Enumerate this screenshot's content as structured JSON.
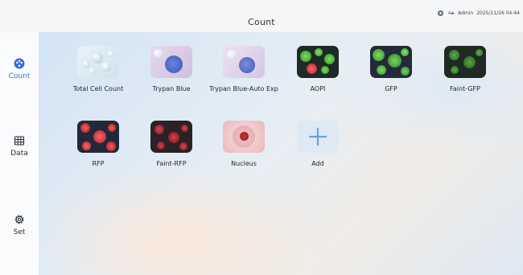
{
  "header": {
    "title": "Count",
    "user": "Admin",
    "datetime": "2025/11/26 04:44"
  },
  "sidebar": {
    "items": [
      {
        "label": "Count",
        "icon": "palette-icon",
        "active": true
      },
      {
        "label": "Data",
        "icon": "table-icon",
        "active": false
      },
      {
        "label": "Set",
        "icon": "gear-icon",
        "active": false
      }
    ]
  },
  "apps": [
    {
      "label": "Total Cell Count",
      "icon": "white-cells-icon"
    },
    {
      "label": "Trypan Blue",
      "icon": "blue-cell-icon"
    },
    {
      "label": "Trypan Blue-Auto Exp",
      "icon": "blue-cell-auto-icon"
    },
    {
      "label": "AOPI",
      "icon": "green-red-cells-icon"
    },
    {
      "label": "GFP",
      "icon": "green-cells-icon"
    },
    {
      "label": "Faint-GFP",
      "icon": "faint-green-cells-icon"
    },
    {
      "label": "RFP",
      "icon": "red-cells-icon"
    },
    {
      "label": "Faint-RFP",
      "icon": "faint-red-cells-icon"
    },
    {
      "label": "Nucleus",
      "icon": "nucleus-icon"
    },
    {
      "label": "Add",
      "icon": "plus-icon"
    }
  ],
  "colors": {
    "accent": "#3b6fd6",
    "add_tile": "#dfe9f3",
    "plus": "#6f9fd8"
  }
}
